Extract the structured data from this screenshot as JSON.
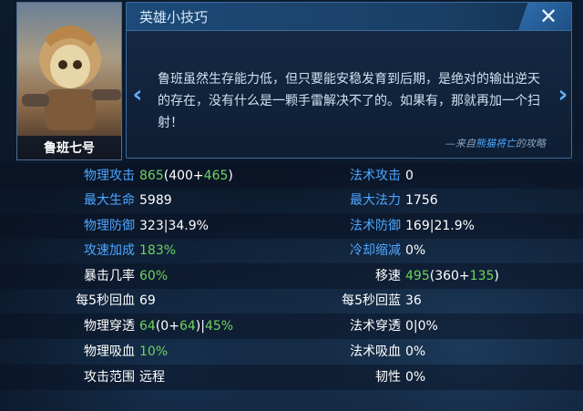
{
  "hero": {
    "name": "鲁班七号"
  },
  "tips": {
    "title": "英雄小技巧",
    "close_icon": "close-icon",
    "text": "鲁班虽然生存能力低，但只要能安稳发育到后期，是绝对的输出逆天的存在，没有什么是一颗手雷解决不了的。如果有，那就再加一个扫射！",
    "source_prefix": "—来自",
    "source_author": "熊猫将亡",
    "source_suffix": "的攻略"
  },
  "stats": {
    "left": [
      {
        "label": "物理攻击",
        "parts": [
          {
            "t": "865",
            "g": true
          },
          {
            "t": "(400+",
            "g": false
          },
          {
            "t": "465",
            "g": true
          },
          {
            "t": ")",
            "g": false
          }
        ]
      },
      {
        "label": "最大生命",
        "parts": [
          {
            "t": "5989",
            "g": false
          }
        ]
      },
      {
        "label": "物理防御",
        "parts": [
          {
            "t": "323|34.9%",
            "g": false
          }
        ]
      },
      {
        "label": "攻速加成",
        "parts": [
          {
            "t": "183%",
            "g": true
          }
        ]
      },
      {
        "label": "暴击几率",
        "parts": [
          {
            "t": "60%",
            "g": true
          }
        ]
      },
      {
        "label": "每5秒回血",
        "parts": [
          {
            "t": "69",
            "g": false
          }
        ]
      },
      {
        "label": "物理穿透",
        "parts": [
          {
            "t": "64",
            "g": true
          },
          {
            "t": "(0+",
            "g": false
          },
          {
            "t": "64",
            "g": true
          },
          {
            "t": ")|",
            "g": false
          },
          {
            "t": "45%",
            "g": true
          }
        ]
      },
      {
        "label": "物理吸血",
        "parts": [
          {
            "t": "10%",
            "g": true
          }
        ]
      },
      {
        "label": "攻击范围",
        "parts": [
          {
            "t": "远程",
            "g": false
          }
        ]
      }
    ],
    "right": [
      {
        "label": "法术攻击",
        "parts": [
          {
            "t": "0",
            "g": false
          }
        ]
      },
      {
        "label": "最大法力",
        "parts": [
          {
            "t": "1756",
            "g": false
          }
        ]
      },
      {
        "label": "法术防御",
        "parts": [
          {
            "t": "169|21.9%",
            "g": false
          }
        ]
      },
      {
        "label": "冷却缩减",
        "parts": [
          {
            "t": "0%",
            "g": false
          }
        ]
      },
      {
        "label": "移速",
        "parts": [
          {
            "t": "495",
            "g": true
          },
          {
            "t": "(360+",
            "g": false
          },
          {
            "t": "135",
            "g": true
          },
          {
            "t": ")",
            "g": false
          }
        ]
      },
      {
        "label": "每5秒回蓝",
        "parts": [
          {
            "t": "36",
            "g": false
          }
        ]
      },
      {
        "label": "法术穿透",
        "parts": [
          {
            "t": "0|0%",
            "g": false
          }
        ]
      },
      {
        "label": "法术吸血",
        "parts": [
          {
            "t": "0%",
            "g": false
          }
        ]
      },
      {
        "label": "韧性",
        "parts": [
          {
            "t": "0%",
            "g": false
          }
        ]
      }
    ]
  },
  "colors": {
    "label_blue": "#4ea6ff",
    "value_green": "#6fd35f",
    "panel_border": "#3b6c9c"
  }
}
